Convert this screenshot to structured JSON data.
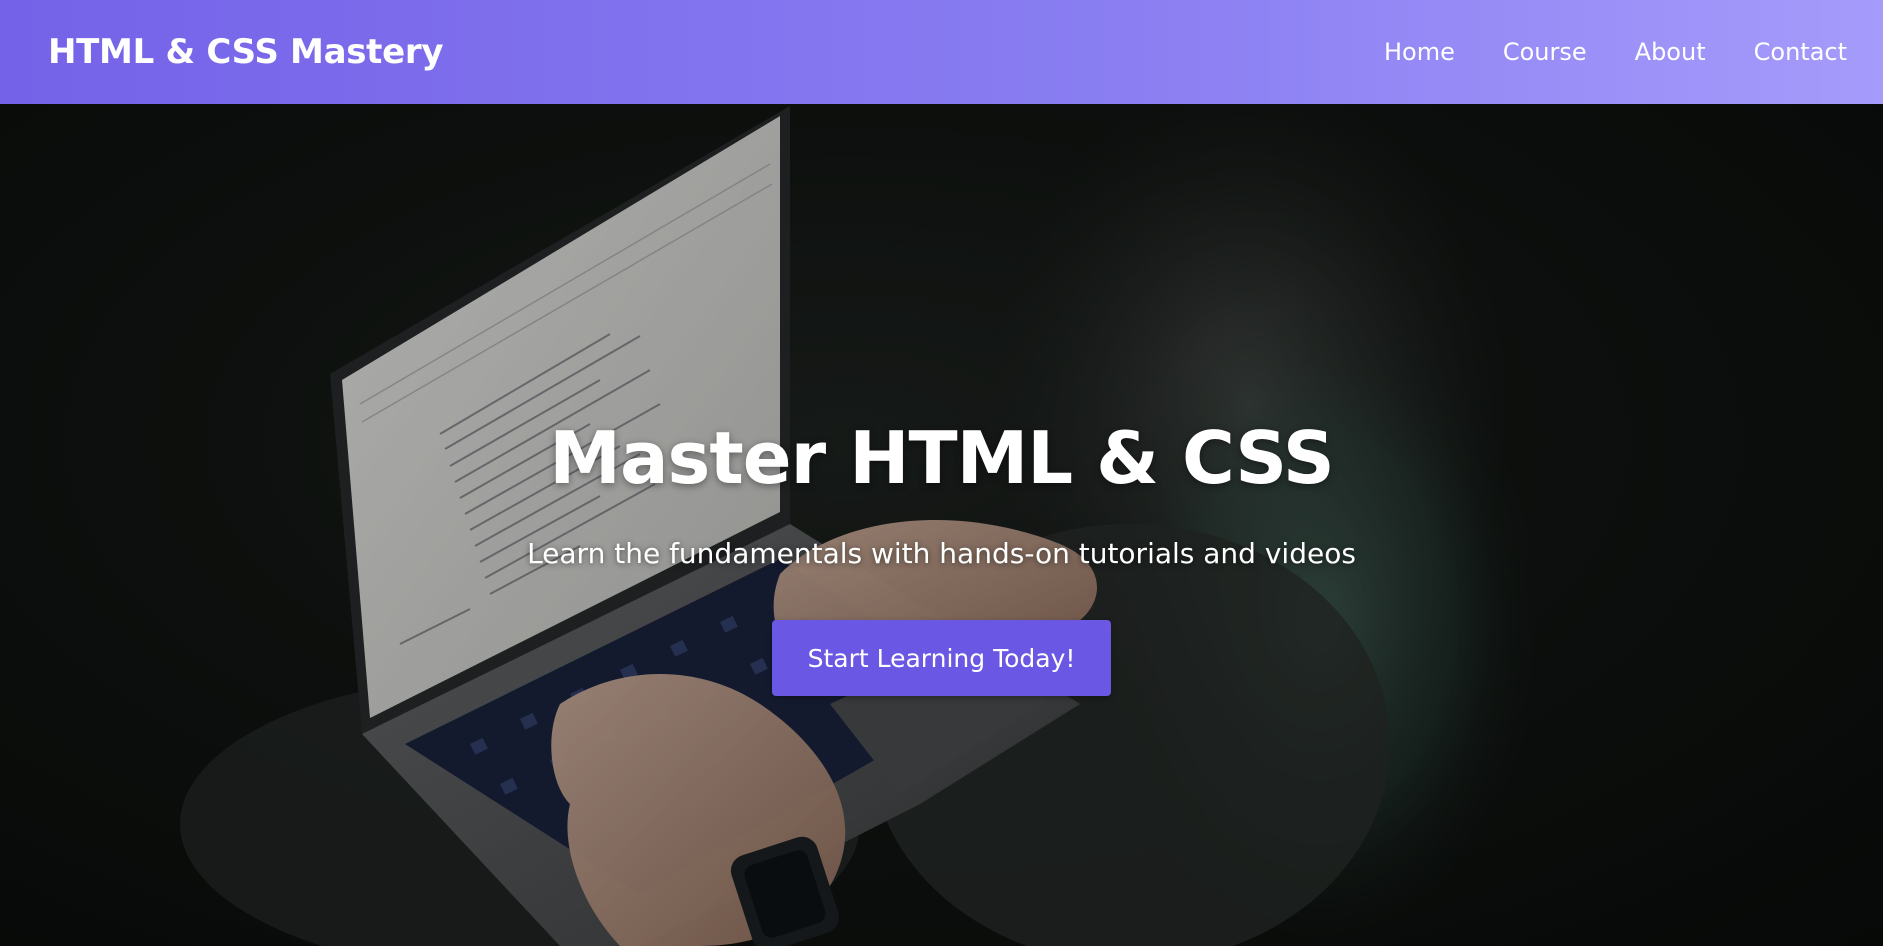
{
  "header": {
    "logo_text": "HTML & CSS Mastery",
    "nav": [
      {
        "label": "Home"
      },
      {
        "label": "Course"
      },
      {
        "label": "About"
      },
      {
        "label": "Contact"
      }
    ]
  },
  "hero": {
    "title": "Master HTML & CSS",
    "subtitle": "Learn the fundamentals with hands-on tutorials and videos",
    "cta_label": "Start Learning Today!",
    "background_image": "person-typing-on-laptop-photo"
  },
  "colors": {
    "header_gradient_start": "#7462e8",
    "header_gradient_end": "#a59bfb",
    "cta_background": "#6a57e3",
    "text": "#ffffff"
  }
}
